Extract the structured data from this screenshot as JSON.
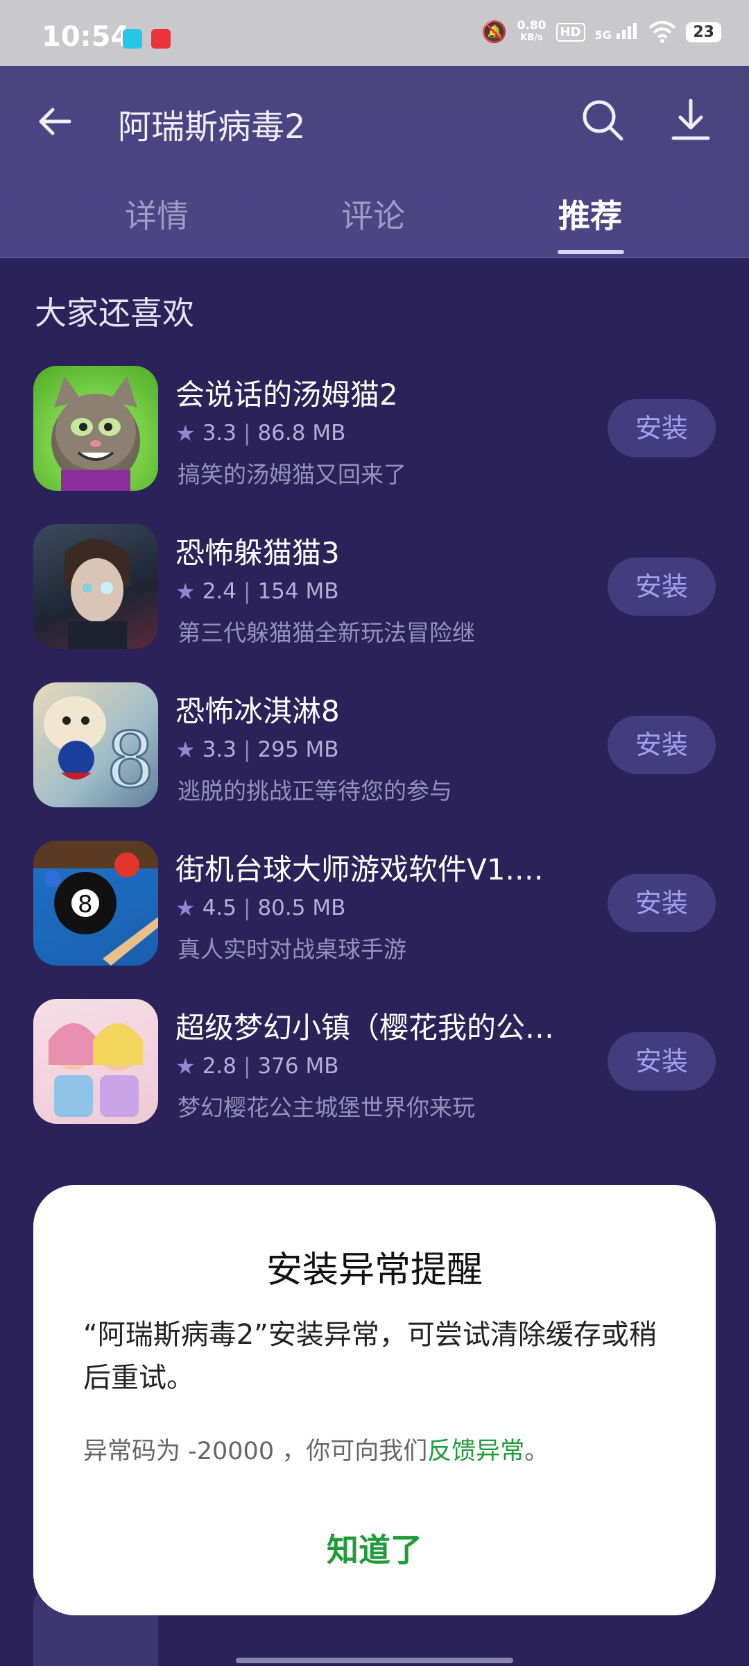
{
  "status_bar": {
    "time": "10:54",
    "speed": "0.80",
    "speed_unit": "KB/s",
    "hd": "HD",
    "network": "5G",
    "battery": "23"
  },
  "header": {
    "title": "阿瑞斯病毒2",
    "tabs": [
      "详情",
      "评论",
      "推荐"
    ],
    "active_tab": "推荐"
  },
  "section": {
    "title": "大家还喜欢"
  },
  "apps": [
    {
      "name": "会说话的汤姆猫2",
      "rating": "3.3",
      "size": "86.8 MB",
      "desc": "搞笑的汤姆猫又回来了",
      "button": "安装"
    },
    {
      "name": "恐怖躲猫猫3",
      "rating": "2.4",
      "size": "154 MB",
      "desc": "第三代躲猫猫全新玩法冒险继",
      "button": "安装"
    },
    {
      "name": "恐怖冰淇淋8",
      "rating": "3.3",
      "size": "295 MB",
      "desc": "逃脱的挑战正等待您的参与",
      "button": "安装"
    },
    {
      "name": "街机台球大师游戏软件V1.…",
      "rating": "4.5",
      "size": "80.5 MB",
      "desc": "真人实时对战桌球手游",
      "button": "安装"
    },
    {
      "name": "超级梦幻小镇（樱花我的公…",
      "rating": "2.8",
      "size": "376 MB",
      "desc": "梦幻樱花公主城堡世界你来玩",
      "button": "安装"
    }
  ],
  "dialog": {
    "title": "安装异常提醒",
    "message": "“阿瑞斯病毒2”安装异常，可尝试清除缓存或稍后重试。",
    "code_prefix": "异常码为 -20000 ，你可向我们",
    "feedback_link": "反馈异常",
    "code_suffix": "。",
    "ok": "知道了"
  },
  "colors": {
    "background": "#2a2258",
    "accent_green": "#1f9b3a",
    "install_button": "#433c7e"
  }
}
